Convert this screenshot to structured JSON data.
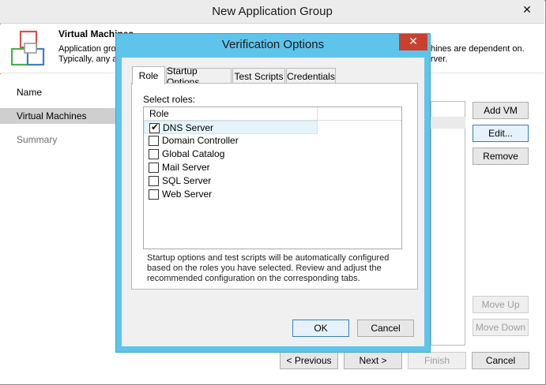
{
  "main": {
    "title": "New Application Group",
    "close_glyph": "✕",
    "header": {
      "title": "Virtual Machines",
      "desc_line1": "Application gro",
      "desc_line2": "Typically, any a",
      "desc_line1_right": "hines are dependent on.",
      "desc_line2_right": "rver."
    },
    "nav": [
      {
        "label": "Name"
      },
      {
        "label": "Virtual Machines"
      },
      {
        "label": "Summary"
      }
    ],
    "side_buttons": {
      "add_vm": "Add VM",
      "edit": "Edit...",
      "remove": "Remove",
      "move_up": "Move Up",
      "move_down": "Move Down"
    },
    "footer_buttons": {
      "previous": "< Previous",
      "next": "Next >",
      "finish": "Finish",
      "cancel": "Cancel"
    }
  },
  "dialog": {
    "title": "Verification Options",
    "close_glyph": "✕",
    "tabs": [
      {
        "label": "Role"
      },
      {
        "label": "Startup Options"
      },
      {
        "label": "Test Scripts"
      },
      {
        "label": "Credentials"
      }
    ],
    "select_label": "Select roles:",
    "grid_header": "Role",
    "roles": [
      {
        "label": "DNS Server",
        "checked": true
      },
      {
        "label": "Domain Controller",
        "checked": false
      },
      {
        "label": "Global Catalog",
        "checked": false
      },
      {
        "label": "Mail Server",
        "checked": false
      },
      {
        "label": "SQL Server",
        "checked": false
      },
      {
        "label": "Web Server",
        "checked": false
      }
    ],
    "check_glyph": "✔",
    "info": {
      "line1": "Startup options and test scripts will be automatically configured",
      "line2": "based on the roles you have selected. Review and adjust the",
      "line3": "recommended configuration on the corresponding tabs."
    },
    "ok_label": "OK",
    "cancel_label": "Cancel"
  },
  "colors": {
    "dialog_frame": "#5ec4eb",
    "close_red": "#c9402e",
    "selected_row": "#e5f3fb"
  }
}
